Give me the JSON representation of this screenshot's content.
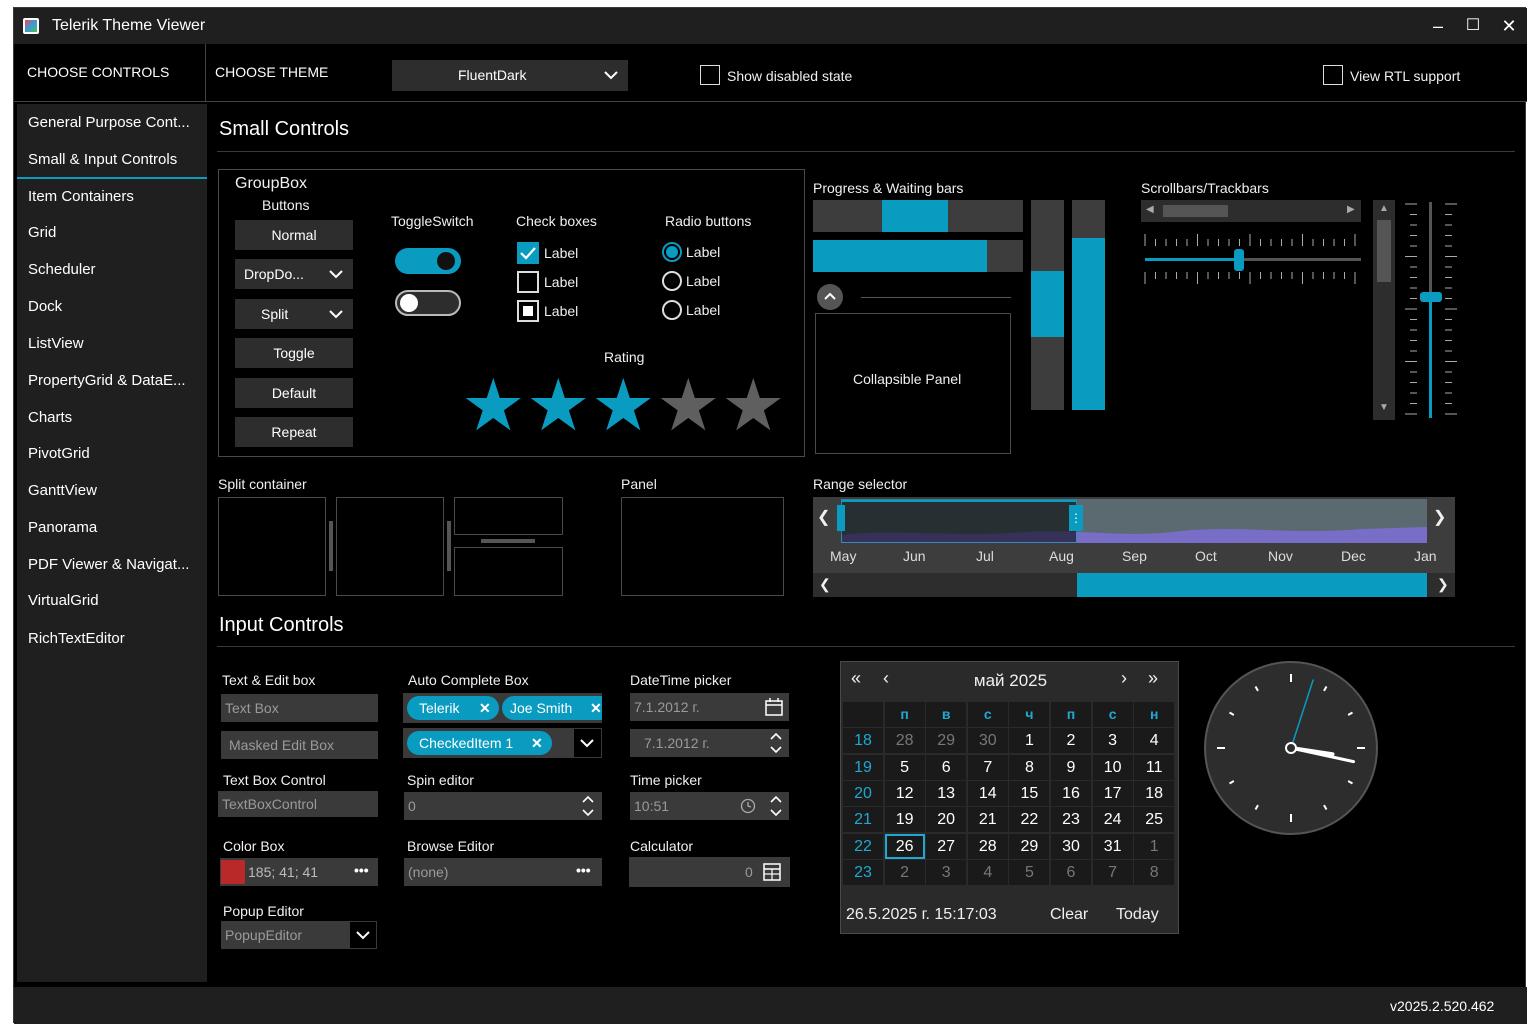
{
  "window": {
    "title": "Telerik Theme Viewer",
    "minimize": "‒",
    "maximize": "☐",
    "close": "✕"
  },
  "toolbar": {
    "choose_controls": "CHOOSE CONTROLS",
    "choose_theme": "CHOOSE THEME",
    "theme_value": "FluentDark",
    "show_disabled": "Show disabled state",
    "view_rtl": "View RTL support"
  },
  "sidebar": {
    "items": [
      {
        "label": "General Purpose Cont..."
      },
      {
        "label": "Small & Input Controls"
      },
      {
        "label": "Item Containers"
      },
      {
        "label": "Grid"
      },
      {
        "label": "Scheduler"
      },
      {
        "label": "Dock"
      },
      {
        "label": "ListView"
      },
      {
        "label": "PropertyGrid & DataE..."
      },
      {
        "label": "Charts"
      },
      {
        "label": "PivotGrid"
      },
      {
        "label": "GanttView"
      },
      {
        "label": "Panorama"
      },
      {
        "label": "PDF Viewer & Navigat..."
      },
      {
        "label": "VirtualGrid"
      },
      {
        "label": "RichTextEditor"
      }
    ],
    "selected_index": 1
  },
  "small": {
    "title": "Small Controls",
    "groupbox": "GroupBox",
    "buttons_label": "Buttons",
    "buttons": {
      "normal": "Normal",
      "dropdown": "DropDo...",
      "split": "Split",
      "toggle": "Toggle",
      "default": "Default",
      "repeat": "Repeat"
    },
    "toggle_label": "ToggleSwitch",
    "toggles": [
      true,
      false
    ],
    "check_label": "Check boxes",
    "checks": [
      {
        "label": "Label",
        "state": "checked"
      },
      {
        "label": "Label",
        "state": "unchecked"
      },
      {
        "label": "Label",
        "state": "indeterminate"
      }
    ],
    "radio_label": "Radio buttons",
    "radios": [
      {
        "label": "Label",
        "selected": true
      },
      {
        "label": "Label",
        "selected": false
      },
      {
        "label": "Label",
        "selected": false
      }
    ],
    "rating_label": "Rating",
    "rating_value": 3,
    "rating_max": 5,
    "progress_label": "Progress & Waiting bars",
    "progress_value": 0.87,
    "collapsible": "Collapsible Panel",
    "scroll_label": "Scrollbars/Trackbars",
    "split_label": "Split container",
    "panel_label": "Panel",
    "range_label": "Range selector",
    "range_months": [
      "May",
      "Jun",
      "Jul",
      "Aug",
      "Sep",
      "Oct",
      "Nov",
      "Dec",
      "Jan"
    ]
  },
  "input": {
    "title": "Input Controls",
    "textedit_label": "Text & Edit box",
    "textbox": "Text Box",
    "masked": "Masked Edit Box",
    "tbc_label": "Text Box Control",
    "tbc": "TextBoxControl",
    "color_label": "Color Box",
    "color_value": "185; 41; 41",
    "color_swatch": "#b92929",
    "popup_label": "Popup Editor",
    "popup_value": "PopupEditor",
    "auto_label": "Auto Complete Box",
    "tokens": [
      "Telerik",
      "Joe Smith"
    ],
    "checked_token": "CheckedItem 1",
    "spin_label": "Spin editor",
    "spin_value": "0",
    "browse_label": "Browse Editor",
    "browse_value": "(none)",
    "dt_label": "DateTime picker",
    "dt_value1": "7.1.2012 г.",
    "dt_value2": "7.1.2012 г.",
    "time_label": "Time picker",
    "time_value": "10:51",
    "calc_label": "Calculator",
    "calc_value": "0"
  },
  "calendar": {
    "title": "май 2025",
    "days": [
      "п",
      "в",
      "с",
      "ч",
      "п",
      "с",
      "н"
    ],
    "weeks": [
      {
        "wk": "18",
        "d": [
          "28",
          "29",
          "30",
          "1",
          "2",
          "3",
          "4"
        ]
      },
      {
        "wk": "19",
        "d": [
          "5",
          "6",
          "7",
          "8",
          "9",
          "10",
          "11"
        ]
      },
      {
        "wk": "20",
        "d": [
          "12",
          "13",
          "14",
          "15",
          "16",
          "17",
          "18"
        ]
      },
      {
        "wk": "21",
        "d": [
          "19",
          "20",
          "21",
          "22",
          "23",
          "24",
          "25"
        ]
      },
      {
        "wk": "22",
        "d": [
          "26",
          "27",
          "28",
          "29",
          "30",
          "31",
          "1"
        ]
      },
      {
        "wk": "23",
        "d": [
          "2",
          "3",
          "4",
          "5",
          "6",
          "7",
          "8"
        ]
      }
    ],
    "footer_date": "26.5.2025 г. 15:17:03",
    "clear": "Clear",
    "today": "Today"
  },
  "clock": {
    "hour": 3,
    "minute": 17,
    "second": 3
  },
  "status": {
    "version": "v2025.2.520.462"
  },
  "colors": {
    "accent": "#0a9bc1",
    "bg": "#000000",
    "panel": "#1f1f1f"
  }
}
